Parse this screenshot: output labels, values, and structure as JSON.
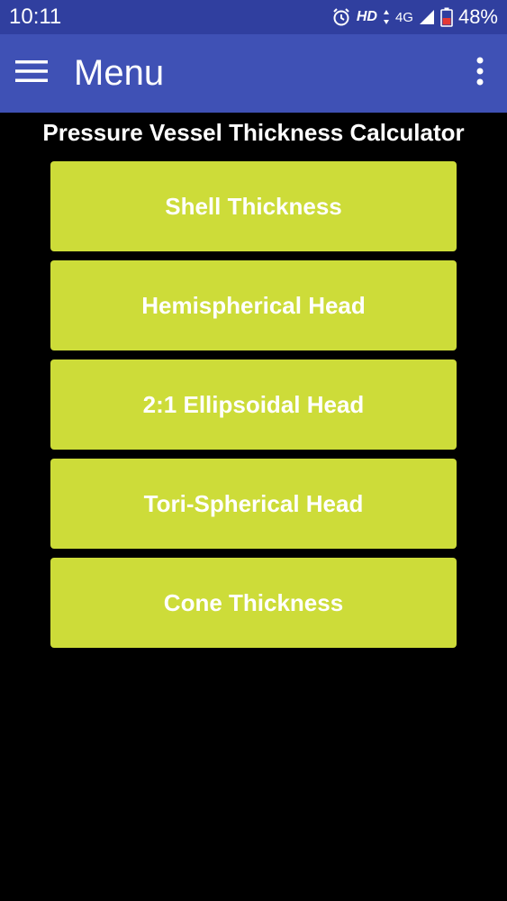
{
  "status_bar": {
    "time": "10:11",
    "hd": "HD",
    "network": "4G",
    "battery": "48%"
  },
  "app_bar": {
    "title": "Menu",
    "nav_icon": "hamburger-menu-icon",
    "overflow_icon": "more-vert-icon"
  },
  "heading": "Pressure Vessel Thickness Calculator",
  "buttons": [
    {
      "label": "Shell Thickness"
    },
    {
      "label": "Hemispherical Head"
    },
    {
      "label": "2:1 Ellipsoidal Head"
    },
    {
      "label": "Tori-Spherical Head"
    },
    {
      "label": "Cone Thickness"
    }
  ],
  "colors": {
    "status_bar": "#303f9f",
    "app_bar": "#3f51b5",
    "button": "#cddc39",
    "background": "#000000",
    "text": "#ffffff"
  }
}
